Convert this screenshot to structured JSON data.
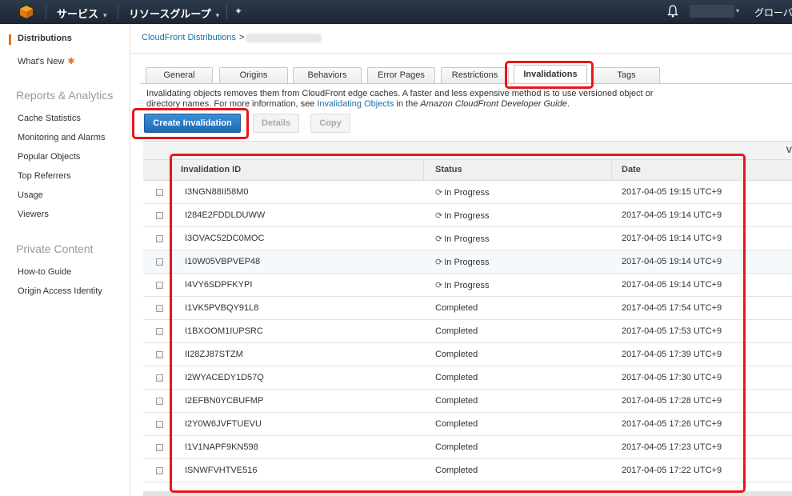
{
  "topnav": {
    "services_label": "サービス",
    "resource_groups_label": "リソースグループ",
    "caret": "▾",
    "pin_glyph": "✦",
    "region_label": "グローバル"
  },
  "sidebar": {
    "items_top": [
      {
        "label": "Distributions",
        "active": true
      },
      {
        "label": "What's New",
        "star": "✱"
      }
    ],
    "reports_heading": "Reports & Analytics",
    "reports_items": [
      "Cache Statistics",
      "Monitoring and Alarms",
      "Popular Objects",
      "Top Referrers",
      "Usage",
      "Viewers"
    ],
    "private_heading": "Private Content",
    "private_items": [
      "How-to Guide",
      "Origin Access Identity"
    ]
  },
  "breadcrumb": {
    "root": "CloudFront Distributions",
    "separator": ">"
  },
  "tabs": [
    "General",
    "Origins",
    "Behaviors",
    "Error Pages",
    "Restrictions",
    "Invalidations",
    "Tags"
  ],
  "active_tab": "Invalidations",
  "description": {
    "text_before": "Invalidating objects removes them from CloudFront edge caches. A faster and less expensive method is to use versioned object or directory names. For more information, see ",
    "link": "Invalidating Objects",
    "text_mid": " in the ",
    "guide": "Amazon CloudFront Developer Guide",
    "text_end": "."
  },
  "buttons": {
    "create": "Create Invalidation",
    "details": "Details",
    "copy": "Copy"
  },
  "table": {
    "top_hint": "V",
    "columns": [
      "Invalidation ID",
      "Status",
      "Date"
    ],
    "rows": [
      {
        "id": "I3NGN88II58M0",
        "status": "In Progress",
        "date": "2017-04-05 19:15 UTC+9"
      },
      {
        "id": "I284E2FDDLDUWW",
        "status": "In Progress",
        "date": "2017-04-05 19:14 UTC+9"
      },
      {
        "id": "I3OVAC52DC0MOC",
        "status": "In Progress",
        "date": "2017-04-05 19:14 UTC+9"
      },
      {
        "id": "I10W05VBPVEP48",
        "status": "In Progress",
        "date": "2017-04-05 19:14 UTC+9"
      },
      {
        "id": "I4VY6SDPFKYPI",
        "status": "In Progress",
        "date": "2017-04-05 19:14 UTC+9"
      },
      {
        "id": "I1VK5PVBQY91L8",
        "status": "Completed",
        "date": "2017-04-05 17:54 UTC+9"
      },
      {
        "id": "I1BXOOM1IUPSRC",
        "status": "Completed",
        "date": "2017-04-05 17:53 UTC+9"
      },
      {
        "id": "II28ZJ87STZM",
        "status": "Completed",
        "date": "2017-04-05 17:39 UTC+9"
      },
      {
        "id": "I2WYACEDY1D57Q",
        "status": "Completed",
        "date": "2017-04-05 17:30 UTC+9"
      },
      {
        "id": "I2EFBN0YCBUFMP",
        "status": "Completed",
        "date": "2017-04-05 17:28 UTC+9"
      },
      {
        "id": "I2Y0W6JVFTUEVU",
        "status": "Completed",
        "date": "2017-04-05 17:26 UTC+9"
      },
      {
        "id": "I1V1NAPF9KN598",
        "status": "Completed",
        "date": "2017-04-05 17:23 UTC+9"
      },
      {
        "id": "ISNWFVHTVE516",
        "status": "Completed",
        "date": "2017-04-05 17:22 UTC+9"
      }
    ]
  },
  "colors": {
    "annotation": "#e8151b",
    "primary": "#1f6ab5",
    "link": "#1a6fa8",
    "accent": "#e7711b"
  }
}
